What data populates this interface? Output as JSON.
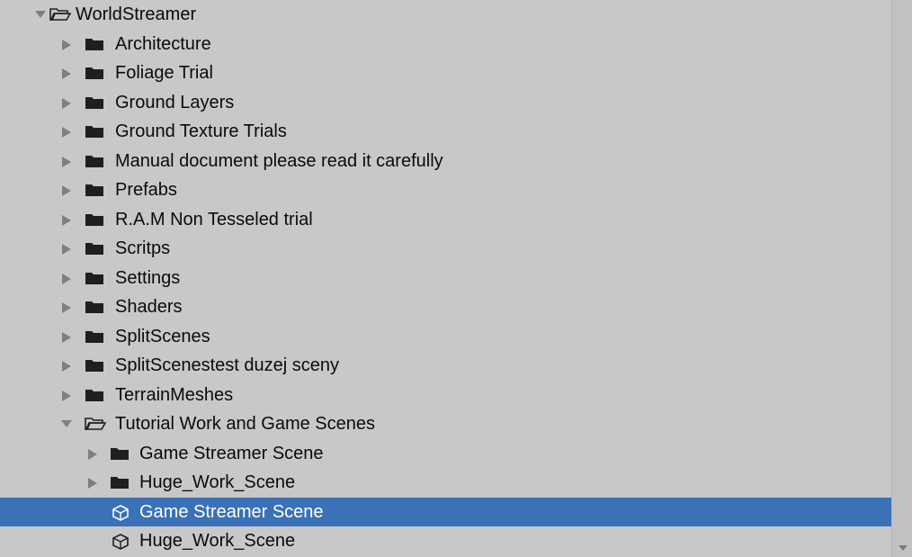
{
  "tree": {
    "items": [
      {
        "label": "WorldStreamer",
        "depth": 0,
        "type": "folder",
        "expanded": true,
        "has_arrow": true,
        "selected": false
      },
      {
        "label": "Architecture",
        "depth": 1,
        "type": "folder",
        "expanded": false,
        "has_arrow": true,
        "selected": false
      },
      {
        "label": "Foliage Trial",
        "depth": 1,
        "type": "folder",
        "expanded": false,
        "has_arrow": true,
        "selected": false
      },
      {
        "label": "Ground Layers",
        "depth": 1,
        "type": "folder",
        "expanded": false,
        "has_arrow": true,
        "selected": false
      },
      {
        "label": "Ground Texture Trials",
        "depth": 1,
        "type": "folder",
        "expanded": false,
        "has_arrow": true,
        "selected": false
      },
      {
        "label": "Manual document please read it carefully",
        "depth": 1,
        "type": "folder",
        "expanded": false,
        "has_arrow": true,
        "selected": false
      },
      {
        "label": "Prefabs",
        "depth": 1,
        "type": "folder",
        "expanded": false,
        "has_arrow": true,
        "selected": false
      },
      {
        "label": "R.A.M Non Tesseled trial",
        "depth": 1,
        "type": "folder",
        "expanded": false,
        "has_arrow": true,
        "selected": false
      },
      {
        "label": "Scritps",
        "depth": 1,
        "type": "folder",
        "expanded": false,
        "has_arrow": true,
        "selected": false
      },
      {
        "label": "Settings",
        "depth": 1,
        "type": "folder",
        "expanded": false,
        "has_arrow": true,
        "selected": false
      },
      {
        "label": "Shaders",
        "depth": 1,
        "type": "folder",
        "expanded": false,
        "has_arrow": true,
        "selected": false
      },
      {
        "label": "SplitScenes",
        "depth": 1,
        "type": "folder",
        "expanded": false,
        "has_arrow": true,
        "selected": false
      },
      {
        "label": "SplitScenestest duzej sceny",
        "depth": 1,
        "type": "folder",
        "expanded": false,
        "has_arrow": true,
        "selected": false
      },
      {
        "label": "TerrainMeshes",
        "depth": 1,
        "type": "folder",
        "expanded": false,
        "has_arrow": true,
        "selected": false
      },
      {
        "label": "Tutorial Work and Game Scenes",
        "depth": 1,
        "type": "folder",
        "expanded": true,
        "has_arrow": true,
        "selected": false
      },
      {
        "label": "Game Streamer Scene",
        "depth": 2,
        "type": "folder",
        "expanded": false,
        "has_arrow": true,
        "selected": false
      },
      {
        "label": "Huge_Work_Scene",
        "depth": 2,
        "type": "folder",
        "expanded": false,
        "has_arrow": true,
        "selected": false
      },
      {
        "label": "Game Streamer Scene",
        "depth": 2,
        "type": "scene",
        "expanded": false,
        "has_arrow": false,
        "selected": true
      },
      {
        "label": "Huge_Work_Scene",
        "depth": 2,
        "type": "scene",
        "expanded": false,
        "has_arrow": false,
        "selected": false
      }
    ]
  },
  "colors": {
    "background": "#c8c8c8",
    "selection": "#3a71b7",
    "text": "#0b0b0b",
    "selected_text": "#ffffff",
    "icon": "#1f1f1f",
    "arrow": "#7f7f7f"
  },
  "icons": {
    "collapsed": "triangle-right-icon",
    "expanded": "triangle-down-icon",
    "folder": "folder-icon",
    "open_folder": "folder-open-icon",
    "scene": "unity-scene-icon"
  }
}
